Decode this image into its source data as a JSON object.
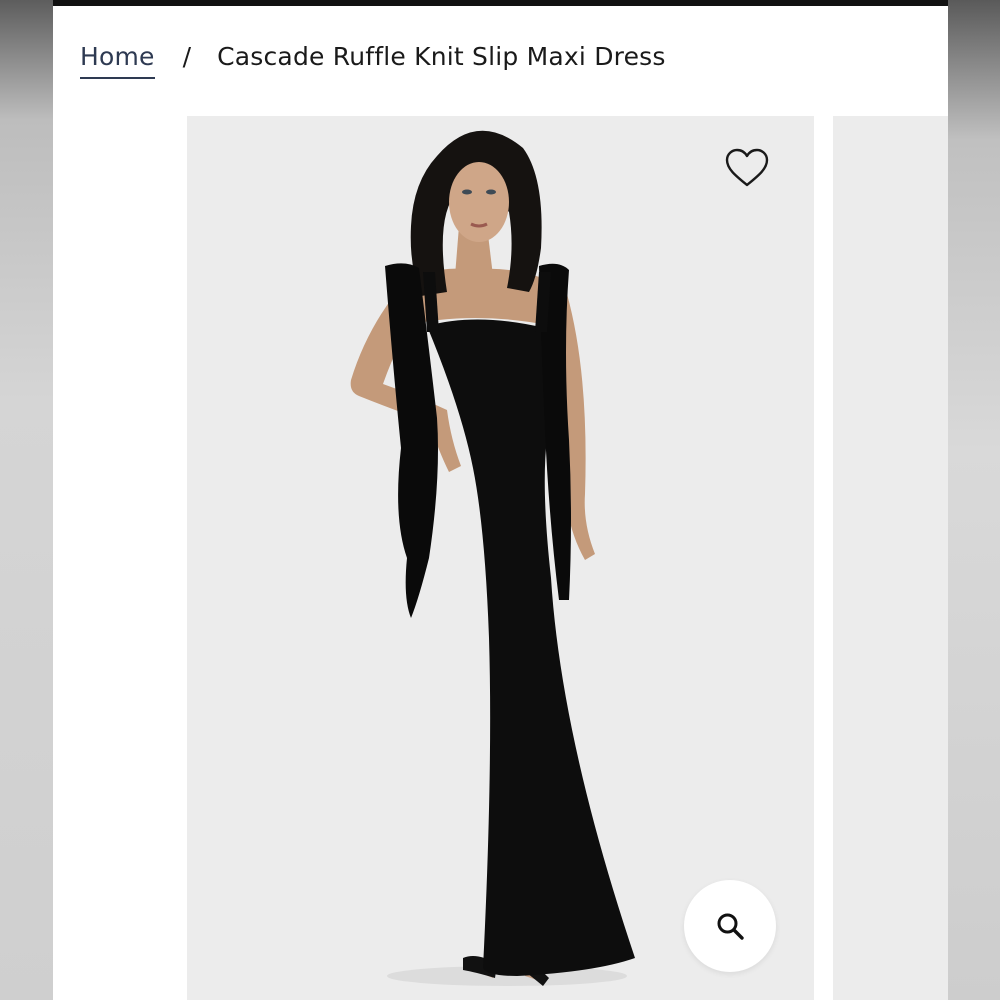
{
  "breadcrumb": {
    "home_label": "Home",
    "separator": "/",
    "current_label": "Cascade Ruffle Knit Slip Maxi Dress"
  },
  "gallery": {
    "image_alt": "Cascade Ruffle Knit Slip Maxi Dress",
    "wishlist_icon": "heart-outline-icon",
    "zoom_icon": "search-icon"
  },
  "colors": {
    "top_bar": "#111111",
    "link": "#2e3a52",
    "gallery_bg": "#ececec",
    "dress": "#0d0d0d"
  }
}
